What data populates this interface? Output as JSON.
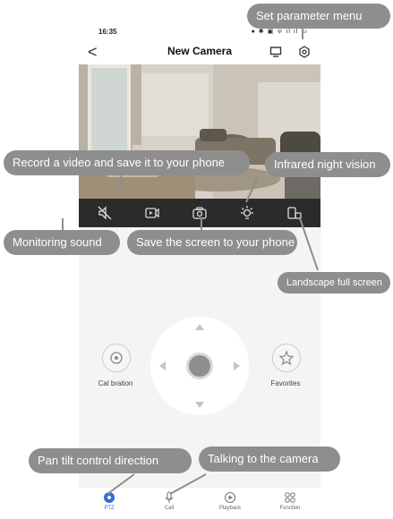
{
  "status_bar": {
    "time": "16:35",
    "indicators": "● ✱ ▣ ᯤ ıl ıl ▭"
  },
  "header": {
    "back_label": "<",
    "title": "New Camera",
    "icons": [
      "monitor-icon",
      "gear-icon"
    ]
  },
  "toolbar": {
    "buttons": [
      {
        "name": "mute-icon"
      },
      {
        "name": "record-icon"
      },
      {
        "name": "camera-icon"
      },
      {
        "name": "night-vision-icon"
      },
      {
        "name": "fullscreen-icon"
      }
    ]
  },
  "ptz": {
    "calibration_label": "Cal bration",
    "favorites_label": "Favorites"
  },
  "bottom_nav": {
    "items": [
      {
        "label": "PTZ",
        "active": true
      },
      {
        "label": "Call",
        "active": false
      },
      {
        "label": "Playback",
        "active": false
      },
      {
        "label": "Function",
        "active": false
      }
    ]
  },
  "callouts": {
    "set_parameter": "Set parameter menu",
    "record_video": "Record a video and save it to your phone",
    "infrared": "Infrared night vision",
    "monitoring_sound": "Monitoring sound",
    "save_screen": "Save the screen to your phone",
    "landscape": "Landscape full screen",
    "pan_tilt": "Pan tilt control direction",
    "talking": "Talking to the camera"
  },
  "colors": {
    "accent": "#2f6fd6",
    "callout": "#8e8e8e",
    "toolbar": "#2b2b2b"
  }
}
